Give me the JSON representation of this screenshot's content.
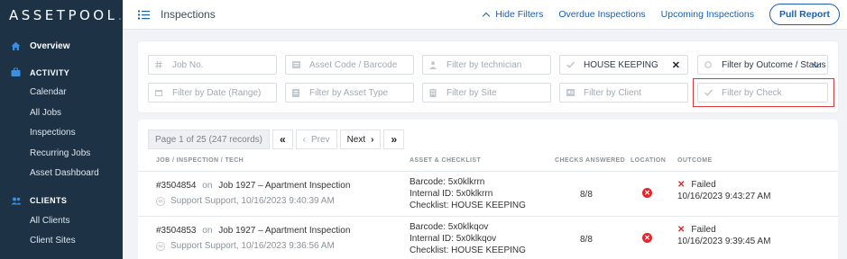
{
  "brand": {
    "name": "ASSETPOOL",
    "dot": "."
  },
  "sidebar": {
    "overview": "Overview",
    "activity_header": "ACTIVITY",
    "activity_items": [
      "Calendar",
      "All Jobs",
      "Inspections",
      "Recurring Jobs",
      "Asset Dashboard"
    ],
    "clients_header": "CLIENTS",
    "clients_items": [
      "All Clients",
      "Client Sites"
    ]
  },
  "header": {
    "title": "Inspections",
    "hide_filters": "Hide Filters",
    "overdue": "Overdue Inspections",
    "upcoming": "Upcoming Inspections",
    "pull_report": "Pull Report"
  },
  "filters": {
    "job_no": "Job No.",
    "asset_code": "Asset Code / Barcode",
    "technician": "Filter by technician",
    "checklist_value": "HOUSE KEEPING",
    "outcome": "Filter by Outcome / Status",
    "date_range": "Filter by Date (Range)",
    "asset_type": "Filter by Asset Type",
    "site": "Filter by Site",
    "client": "Filter by Client",
    "check": "Filter by Check"
  },
  "pager": {
    "info": "Page 1 of 25 (247 records)",
    "first": "«",
    "prev": "Prev",
    "next": "Next",
    "last": "»"
  },
  "table": {
    "headers": {
      "job": "JOB / INSPECTION / TECH",
      "asset": "ASSET & CHECKLIST",
      "checks": "CHECKS ANSWERED",
      "location": "LOCATION",
      "outcome": "OUTCOME"
    },
    "rows": [
      {
        "job_id": "#3504854",
        "on": "on",
        "job_name": "Job 1927 – Apartment Inspection",
        "avatar": "SS",
        "tech": "Support Support, 10/16/2023 9:40:39 AM",
        "barcode": "Barcode: 5x0klkrrn",
        "internal_id": "Internal ID: 5x0klkrrn",
        "checklist": "Checklist: HOUSE KEEPING",
        "checks": "8/8",
        "outcome": "Failed",
        "outcome_time": "10/16/2023 9:43:27 AM"
      },
      {
        "job_id": "#3504853",
        "on": "on",
        "job_name": "Job 1927 – Apartment Inspection",
        "avatar": "SS",
        "tech": "Support Support, 10/16/2023 9:36:56 AM",
        "barcode": "Barcode: 5x0klkqov",
        "internal_id": "Internal ID: 5x0klkqov",
        "checklist": "Checklist: HOUSE KEEPING",
        "checks": "8/8",
        "outcome": "Failed",
        "outcome_time": "10/16/2023 9:39:45 AM"
      }
    ]
  },
  "colors": {
    "sidebar_bg": "#1e3246",
    "accent": "#1a5fb4",
    "failed": "#e0282e",
    "highlight": "#d9393c"
  }
}
